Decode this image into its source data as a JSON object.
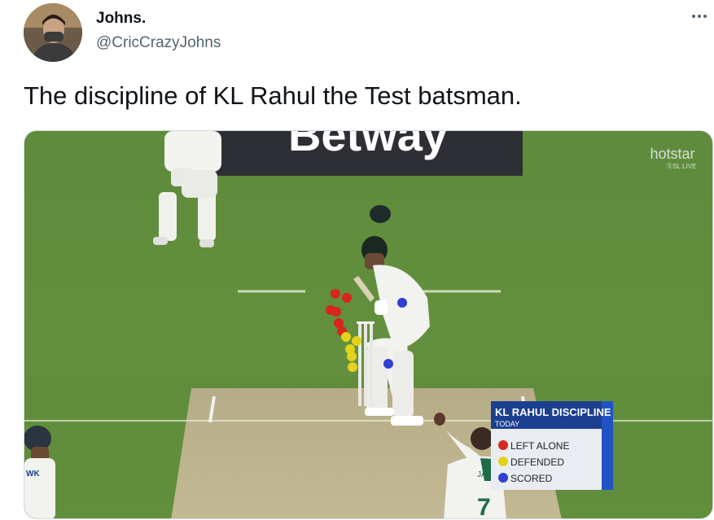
{
  "author": {
    "name": "Johns.",
    "handle": "@CricCrazyJohns",
    "avatar_icon": "user-avatar"
  },
  "more_icon": "more-horizontal-icon",
  "tweet": {
    "text": "The discipline of KL Rahul the Test batsman."
  },
  "media": {
    "sponsor_board": "Betway",
    "broadcaster_logo": "hotstar",
    "broadcaster_sub": "ⓈSL LIVE",
    "keeper_tag": "WK",
    "bowler_shirt_name": "JANS",
    "bowler_shirt_number": "7",
    "graphic": {
      "title": "KL RAHUL DISCIPLINE",
      "subtitle": "TODAY",
      "legend": [
        {
          "label": "LEFT ALONE",
          "color": "#d7261e"
        },
        {
          "label": "DEFENDED",
          "color": "#e3d21c"
        },
        {
          "label": "SCORED",
          "color": "#2f3fd0"
        }
      ]
    },
    "colors": {
      "grass": "#5f8e3f",
      "pitch": "#b9b08a",
      "graphic_header": "#1c3f8f"
    }
  }
}
